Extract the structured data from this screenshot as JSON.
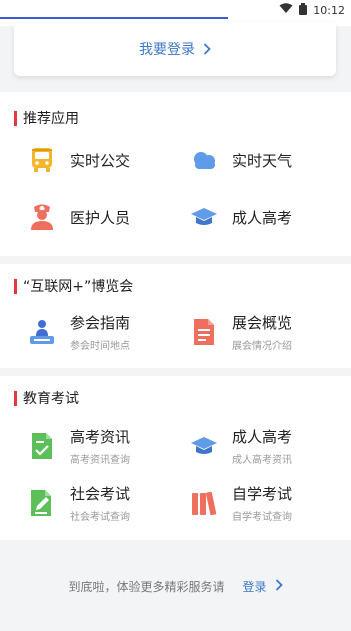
{
  "status": {
    "time": "10:12"
  },
  "login_card": {
    "label": "我要登录"
  },
  "sections": {
    "recommended": {
      "title": "推荐应用",
      "items": [
        {
          "label": "实时公交",
          "icon": "bus-icon"
        },
        {
          "label": "实时天气",
          "icon": "cloud-icon"
        },
        {
          "label": "医护人员",
          "icon": "nurse-icon"
        },
        {
          "label": "成人高考",
          "icon": "graduation-cap-icon"
        }
      ]
    },
    "expo": {
      "title": "“互联网+”博览会",
      "items": [
        {
          "label": "参会指南",
          "sub": "参会时间地点",
          "icon": "attendee-icon"
        },
        {
          "label": "展会概览",
          "sub": "展会情况介绍",
          "icon": "document-icon"
        }
      ]
    },
    "education": {
      "title": "教育考试",
      "items": [
        {
          "label": "高考资讯",
          "sub": "高考资讯查询",
          "icon": "check-document-icon"
        },
        {
          "label": "成人高考",
          "sub": "成人高考资讯",
          "icon": "graduation-cap-icon"
        },
        {
          "label": "社会考试",
          "sub": "社会考试查询",
          "icon": "edit-document-icon"
        },
        {
          "label": "自学考试",
          "sub": "自学考试查询",
          "icon": "books-icon"
        }
      ]
    }
  },
  "footer": {
    "text": "到底啦，体验更多精彩服务请",
    "link": "登录"
  },
  "colors": {
    "accent": "#3f78c8",
    "section_bar": "#e0393e",
    "background": "#f3f4f6"
  }
}
